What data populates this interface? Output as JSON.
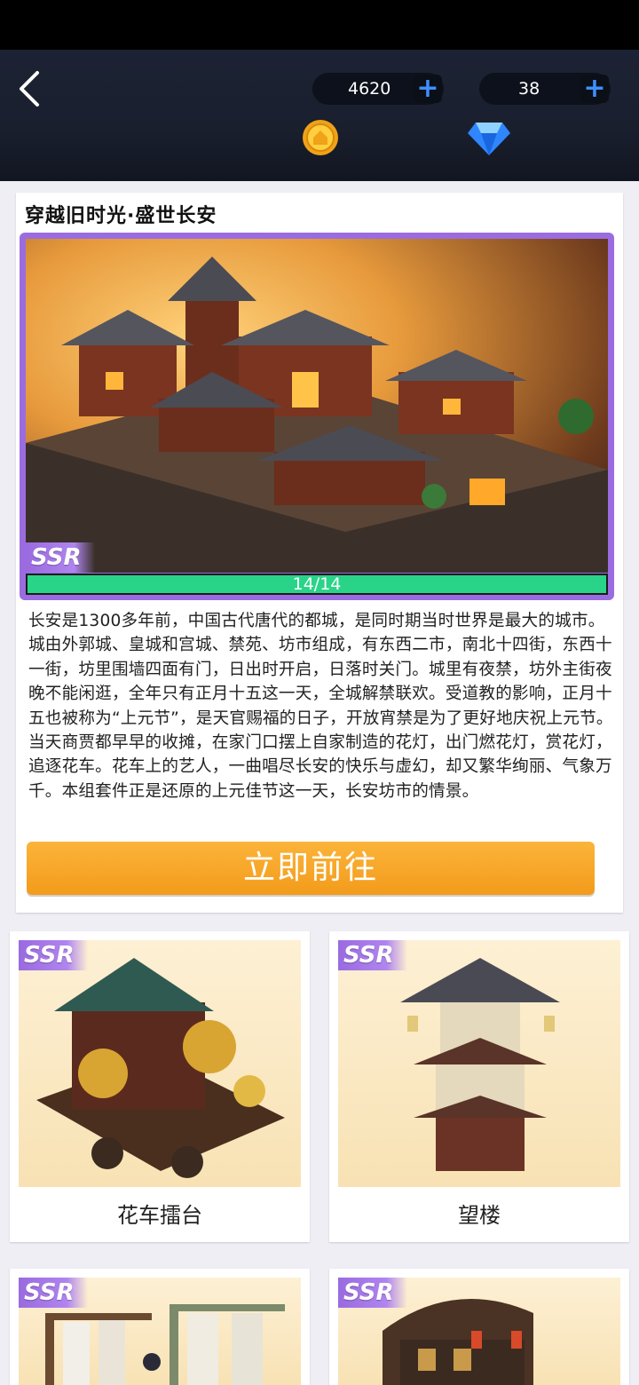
{
  "header": {
    "coins": "4620",
    "gems": "38",
    "plus_symbol": "+"
  },
  "main_card": {
    "title": "穿越旧时光·盛世长安",
    "rarity": "SSR",
    "progress_text": "14/14",
    "progress": 1.0,
    "description": "长安是1300多年前，中国古代唐代的都城，是同时期当时世界是最大的城市。城由外郭城、皇城和宫城、禁苑、坊市组成，有东西二市，南北十四街，东西十一街，坊里围墙四面有门，日出时开启，日落时关门。城里有夜禁，坊外主街夜晚不能闲逛，全年只有正月十五这一天，全城解禁联欢。受道教的影响，正月十五也被称为“上元节”，是天官赐福的日子，开放宵禁是为了更好地庆祝上元节。当天商贾都早早的收摊，在家门口摆上自家制造的花灯，出门燃花灯，赏花灯，追逐花车。花车上的艺人，一曲唱尽长安的快乐与虚幻，却又繁华绚丽、气象万千。本组套件正是还原的上元佳节这一天，长安坊市的情景。",
    "button_label": "立即前往"
  },
  "items": [
    {
      "rarity": "SSR",
      "label": "花车擂台"
    },
    {
      "rarity": "SSR",
      "label": "望楼"
    },
    {
      "rarity": "SSR",
      "label": ""
    },
    {
      "rarity": "SSR",
      "label": ""
    }
  ],
  "colors": {
    "accent_purple": "#9b6ce0",
    "progress_green": "#2cd38a",
    "button_orange": "#f5a125",
    "plus_blue": "#3f8fff"
  },
  "icons": [
    "back-arrow-icon",
    "coin-icon",
    "diamond-icon",
    "plus-icon"
  ]
}
